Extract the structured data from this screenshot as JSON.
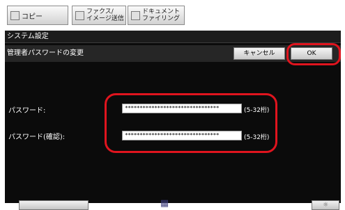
{
  "tabs": {
    "copy": {
      "label": "コピー",
      "icon": "copy-icon"
    },
    "fax": {
      "line1": "ファクス/",
      "line2": "イメージ送信",
      "icon": "fax-icon"
    },
    "doc": {
      "line1": "ドキュメント",
      "line2": "ファイリング",
      "icon": "document-filing-icon"
    }
  },
  "screen": {
    "title": "システム設定",
    "header": "管理者パスワードの変更",
    "cancel_label": "キャンセル",
    "ok_label": "OK"
  },
  "fields": {
    "password": {
      "label": "パスワード:",
      "value": "********************************",
      "hint": "(5-32桁)"
    },
    "confirm": {
      "label": "パスワード(確認):",
      "value": "********************************",
      "hint": "(5-32桁)"
    }
  },
  "bottom": {
    "center_icon": "job-status-icon",
    "right_icon": "brightness-icon",
    "right_symbol": "☼"
  },
  "colors": {
    "highlight": "#e0141e",
    "screen_bg": "#0b0b0b"
  }
}
